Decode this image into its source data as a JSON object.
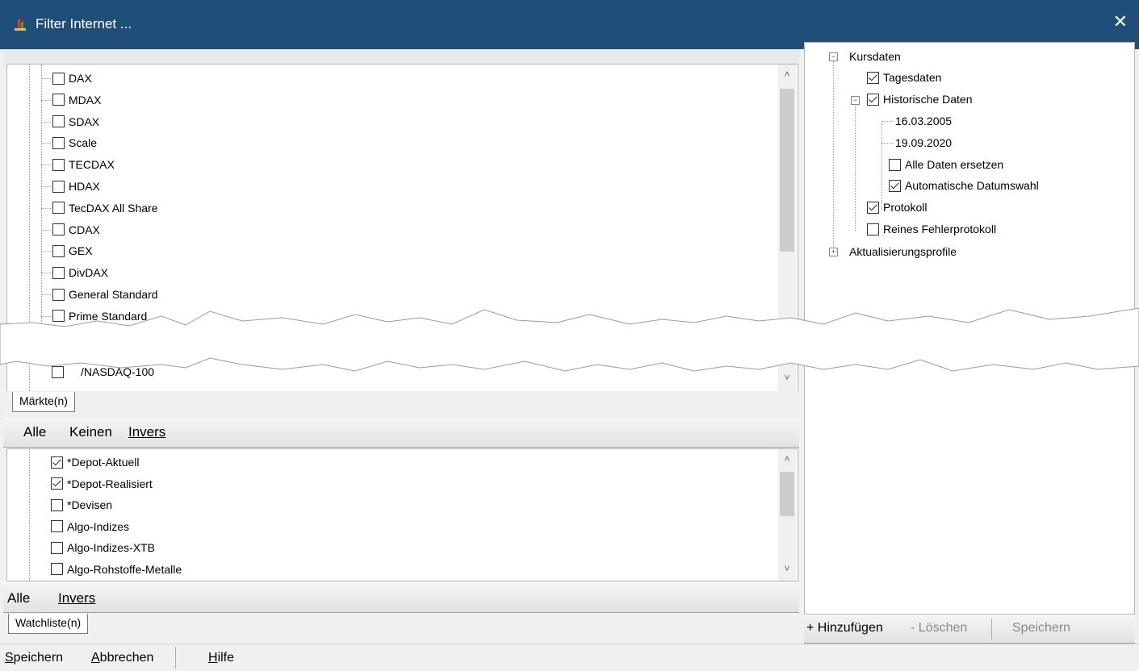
{
  "window": {
    "title": "Filter Internet ...",
    "close_symbol": "✕"
  },
  "markets": {
    "items": [
      {
        "label": "DAX",
        "checked": false
      },
      {
        "label": "MDAX",
        "checked": false
      },
      {
        "label": "SDAX",
        "checked": false
      },
      {
        "label": "Scale",
        "checked": false
      },
      {
        "label": "TECDAX",
        "checked": false
      },
      {
        "label": "HDAX",
        "checked": false
      },
      {
        "label": "TecDAX All Share",
        "checked": false
      },
      {
        "label": "CDAX",
        "checked": false
      },
      {
        "label": "GEX",
        "checked": false
      },
      {
        "label": "DivDAX",
        "checked": false
      },
      {
        "label": "General Standard",
        "checked": false
      },
      {
        "label": "Prime Standard",
        "checked": false
      }
    ],
    "partial_item": "/NASDAQ-100",
    "tab_label": "Märkte(n)",
    "buttons": {
      "all": "Alle",
      "none": "Keinen",
      "invert": "Invers"
    }
  },
  "watchlist": {
    "items": [
      {
        "label": "*Depot-Aktuell",
        "checked": true
      },
      {
        "label": "*Depot-Realisiert",
        "checked": true
      },
      {
        "label": "*Devisen",
        "checked": false
      },
      {
        "label": "Algo-Indizes",
        "checked": false
      },
      {
        "label": "Algo-Indizes-XTB",
        "checked": false
      },
      {
        "label": "Algo-Rohstoffe-Metalle",
        "checked": false
      }
    ],
    "tab_label": "Watchliste(n)",
    "buttons": {
      "all": "Alle",
      "invert": "Invers"
    }
  },
  "settings_tree": {
    "kursdaten": "Kursdaten",
    "tagesdaten": "Tagesdaten",
    "historische_daten": "Historische Daten",
    "date_from": "16.03.2005",
    "date_to": "19.09.2020",
    "alle_daten_ersetzen": "Alle Daten ersetzen",
    "automatische_datumswahl": "Automatische Datumswahl",
    "protokoll": "Protokoll",
    "reines_fehlerprotokoll": "Reines Fehlerprotokoll",
    "aktualisierungsprofile": "Aktualisierungsprofile",
    "expander_minus": "−",
    "expander_plus": "+"
  },
  "profile_bar": {
    "add": "+ Hinzufügen",
    "delete": "- Löschen",
    "save": "Speichern"
  },
  "footer": {
    "save": "Speichern",
    "cancel": "Abbrechen",
    "help": "Hilfe"
  },
  "scroll_arrows": {
    "up": "˄",
    "down": "˅"
  }
}
